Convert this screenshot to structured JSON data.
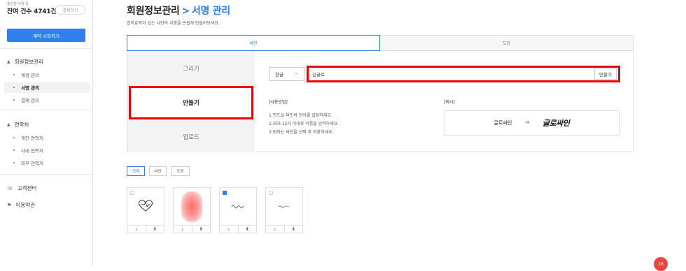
{
  "sidebar": {
    "subtitle": "충전형 이용 중",
    "balance": "잔여 건수 4741건",
    "pay_button": "결제하기",
    "start_button": "계약 시작하기",
    "group1": {
      "label": "회원정보관리",
      "items": [
        "계정 관리",
        "서명 관리",
        "결제 관리"
      ],
      "active": 1
    },
    "group2": {
      "label": "연락처",
      "items": [
        "개인 연락처",
        "사내 연락처",
        "외부 연락처"
      ]
    },
    "support": "고객센터",
    "terms": "이용약관"
  },
  "header": {
    "parent": "회원정보관리",
    "separator": ">",
    "current": "서명 관리",
    "description": "법적효력이 있는 나만의 서명을 손쉽게 만들어보세요."
  },
  "tabs": [
    "싸인",
    "도장"
  ],
  "method_tabs": [
    "그리기",
    "만들기",
    "업로드"
  ],
  "maker": {
    "language": "한글",
    "name_value": "김글로",
    "make_button": "만들기"
  },
  "howto": {
    "heading": "[사용방법]",
    "steps": [
      "1.만드실 싸인의 언어를 설정하세요.",
      "2.최대 12자 이내로 이름을 입력하세요.",
      "3.원하는 싸인을 선택 후 저장하세요."
    ]
  },
  "example": {
    "heading": "[예시]",
    "input_text": "글로싸인",
    "arrow": "➔",
    "output_text": "글로싸인"
  },
  "filter_tabs": [
    "전체",
    "싸인",
    "도장"
  ],
  "card_icons": {
    "download": "download-icon",
    "delete": "trash-icon"
  },
  "notification_count": "16",
  "colors": {
    "accent": "#2f80ed",
    "highlight": "#e00000",
    "badge": "#e8453c"
  }
}
